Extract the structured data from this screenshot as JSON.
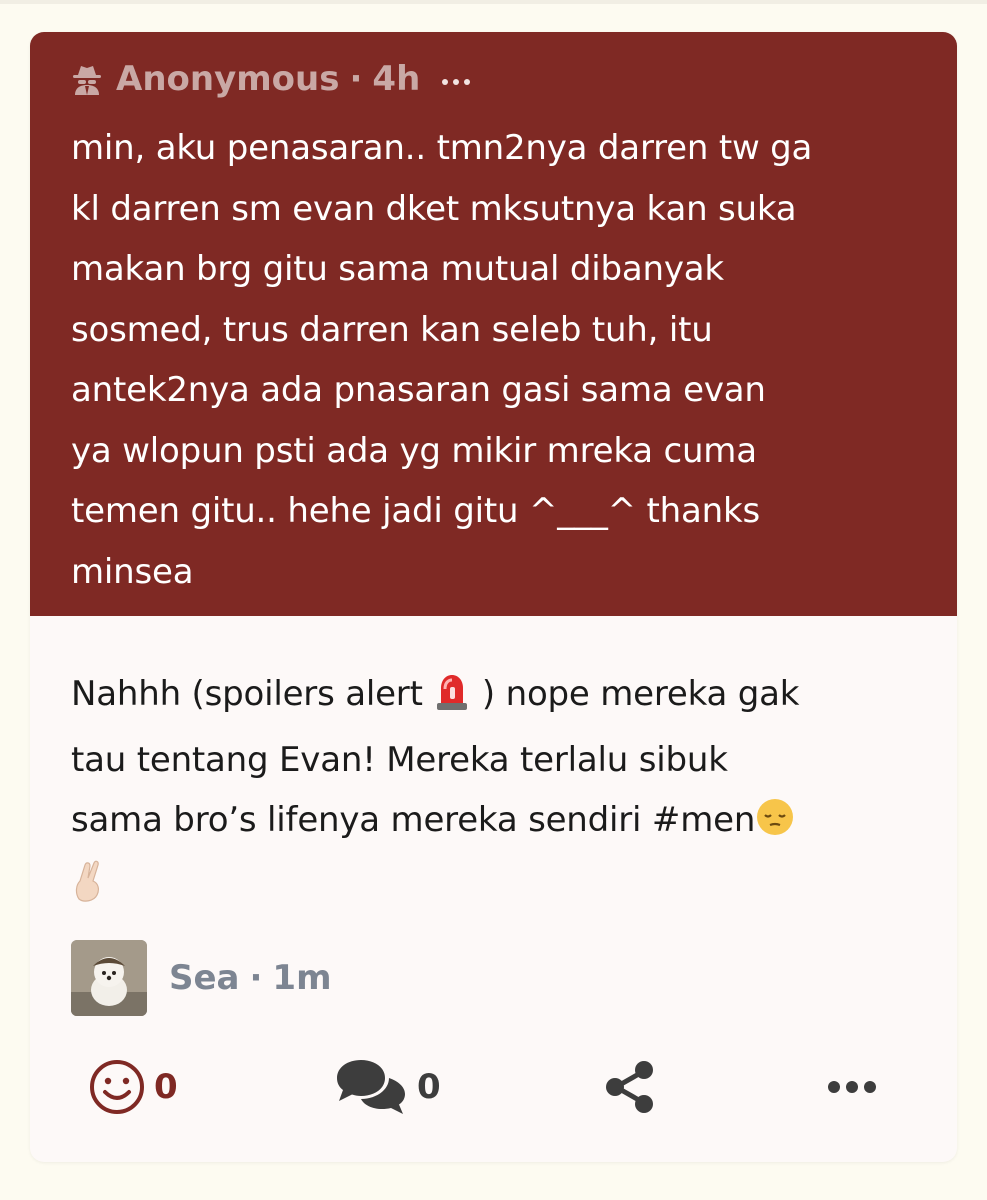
{
  "question": {
    "author": "Anonymous",
    "separator": "·",
    "time": "4h",
    "text": "min, aku penasaran.. tmn2nya darren tw ga\nkl darren sm evan dket mksutnya kan suka\nmakan brg gitu sama mutual dibanyak\nsosmed, trus darren kan seleb tuh, itu\nantek2nya ada pnasaran gasi sama evan\nya wlopun psti ada yg mikir mreka cuma\ntemen gitu.. hehe jadi gitu ^___^ thanks\nminsea",
    "author_icon": "spy-icon",
    "menu_icon": "ellipsis-icon"
  },
  "answer": {
    "line1_a": "Nahhh (spoilers alert ",
    "line1_b": " ) nope mereka gak",
    "line2": "tau tentang Evan! Mereka terlalu sibuk",
    "line3": "sama bro’s lifenya mereka sendiri #men",
    "emoji_siren": "🚨",
    "emoji_relieved": "😔",
    "emoji_fingers": "🤞🏻"
  },
  "responder": {
    "name": "Sea",
    "separator": "·",
    "time": "1m",
    "avatar_icon": "dog-avatar"
  },
  "actions": {
    "reactions_count": "0",
    "comments_count": "0",
    "react_icon": "smiley-icon",
    "comment_icon": "comments-icon",
    "share_icon": "share-icon",
    "more_icon": "ellipsis-icon"
  },
  "colors": {
    "question_bg": "#7f2924",
    "accent": "#7f2924",
    "page_bg": "#fdfbf1",
    "card_bg": "#fdf9f8",
    "meta_gray": "#7d8592"
  }
}
